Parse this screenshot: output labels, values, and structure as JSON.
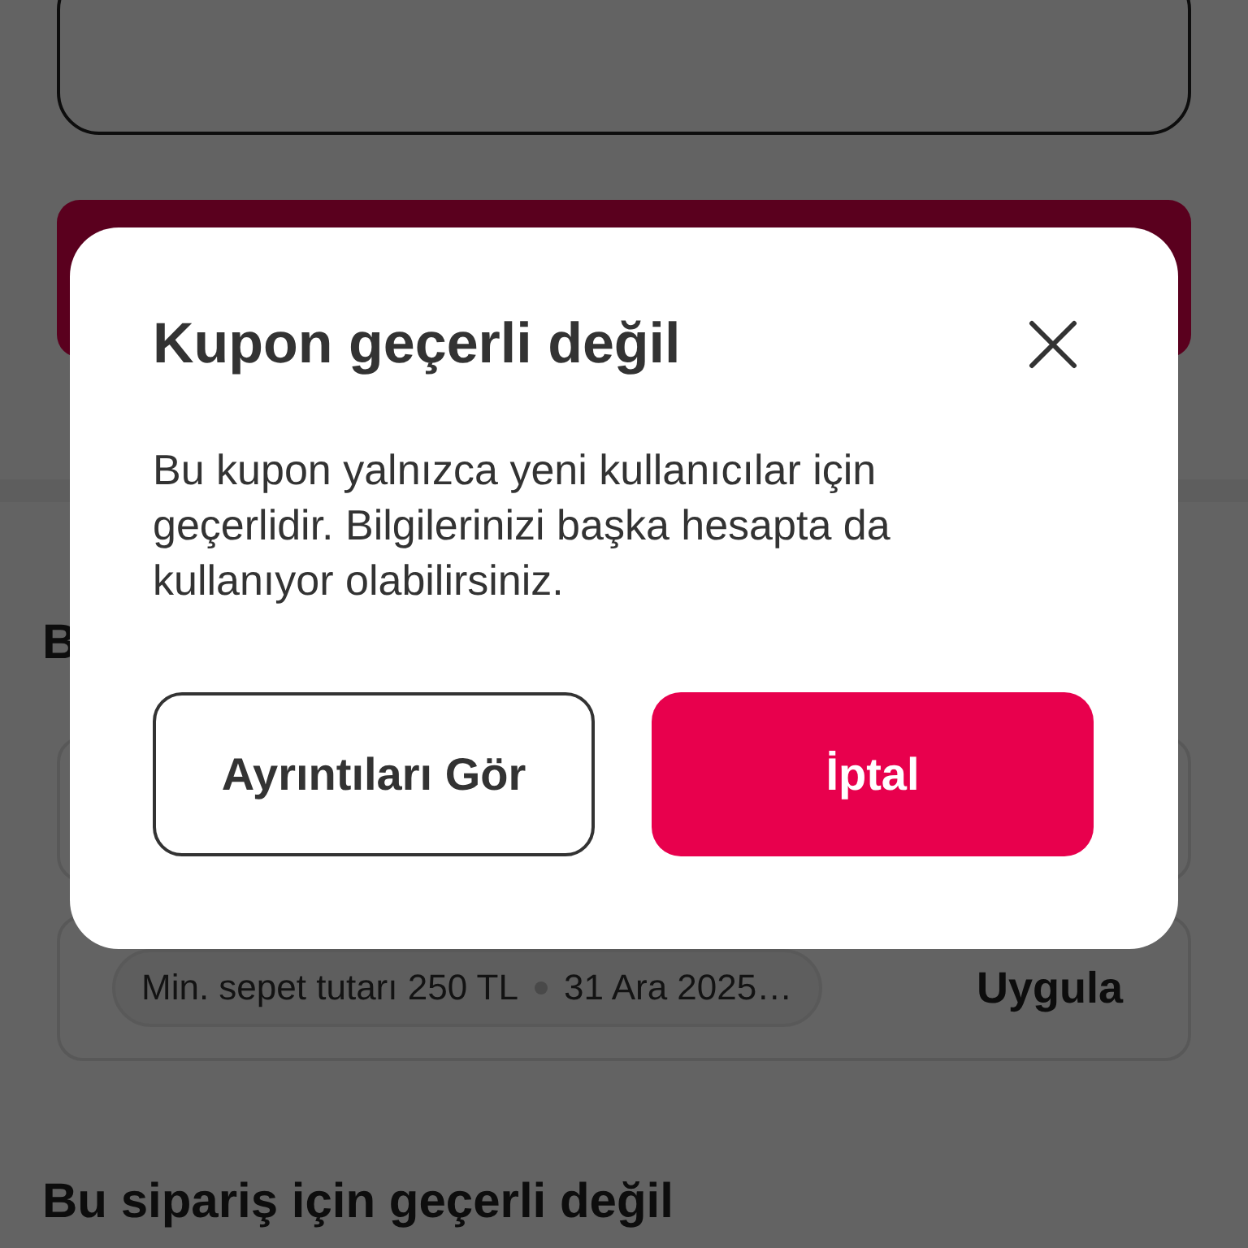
{
  "page": {
    "section_heading": "B",
    "coupon_card": {
      "conditions": [
        "Min. sepet tutarı 250 TL",
        "31 Ara 2025…"
      ],
      "action": "Uygula"
    },
    "invalid_heading": "Bu sipariş için geçerli değil"
  },
  "dialog": {
    "title": "Kupon geçerli değil",
    "message": "Bu kupon yalnızca yeni kullanıcılar için geçerlidir. Bilgilerinizi başka hesapta da kullanıyor olabilirsiniz.",
    "buttons": [
      {
        "label": "Ayrıntıları Gör",
        "kind": "secondary"
      },
      {
        "label": "İptal",
        "kind": "primary"
      }
    ]
  }
}
